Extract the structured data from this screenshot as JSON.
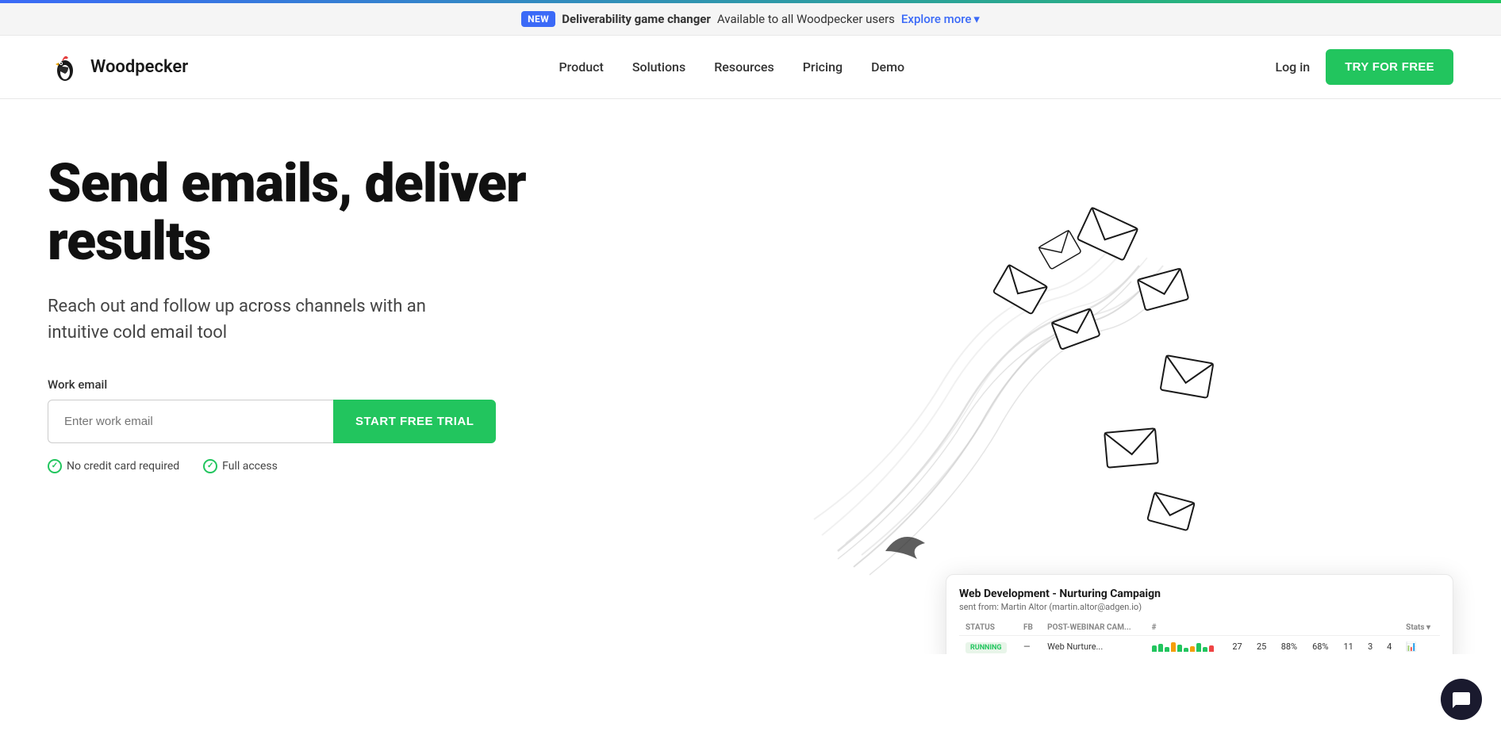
{
  "topBorder": true,
  "announcement": {
    "badge": "NEW",
    "boldText": "Deliverability game changer",
    "subText": "Available to all Woodpecker users",
    "linkText": "Explore more",
    "chevron": "▾"
  },
  "nav": {
    "logo": {
      "text": "Woodpecker",
      "ariaLabel": "Woodpecker home"
    },
    "links": [
      {
        "label": "Product",
        "href": "#"
      },
      {
        "label": "Solutions",
        "href": "#"
      },
      {
        "label": "Resources",
        "href": "#"
      },
      {
        "label": "Pricing",
        "href": "#"
      },
      {
        "label": "Demo",
        "href": "#"
      }
    ],
    "loginLabel": "Log in",
    "tryButtonLabel": "TRY FOR FREE"
  },
  "hero": {
    "title": "Send emails, deliver results",
    "subtitle": "Reach out and follow up across channels with an intuitive cold email tool",
    "emailLabel": "Work email",
    "emailPlaceholder": "Enter work email",
    "ctaButton": "START FREE TRIAL",
    "trustBadges": [
      {
        "text": "No credit card required"
      },
      {
        "text": "Full access"
      }
    ]
  },
  "dashboard": {
    "campaignName": "Web Development - Nurturing Campaign",
    "sentFrom": "sent from: Martin Altor (martin.altor@adgen.io)",
    "columns": [
      "STATUS",
      "FB",
      "POST-WEBINAR CAM...",
      "#",
      "",
      "",
      "",
      "",
      "",
      "",
      "Stats"
    ],
    "stats": {
      "sent": "27",
      "opened": "25",
      "openRate": "88%",
      "clickRate": "68%",
      "col1": "11",
      "col2": "3",
      "col3": "4"
    },
    "progressBars": [
      {
        "height": 8,
        "color": "#22c55e"
      },
      {
        "height": 10,
        "color": "#22c55e"
      },
      {
        "height": 6,
        "color": "#22c55e"
      },
      {
        "height": 12,
        "color": "#f59e0b"
      },
      {
        "height": 9,
        "color": "#22c55e"
      },
      {
        "height": 5,
        "color": "#22c55e"
      },
      {
        "height": 7,
        "color": "#f59e0b"
      },
      {
        "height": 11,
        "color": "#22c55e"
      },
      {
        "height": 6,
        "color": "#22c55e"
      },
      {
        "height": 8,
        "color": "#ef4444"
      }
    ]
  },
  "chat": {
    "iconLabel": "chat-icon"
  }
}
